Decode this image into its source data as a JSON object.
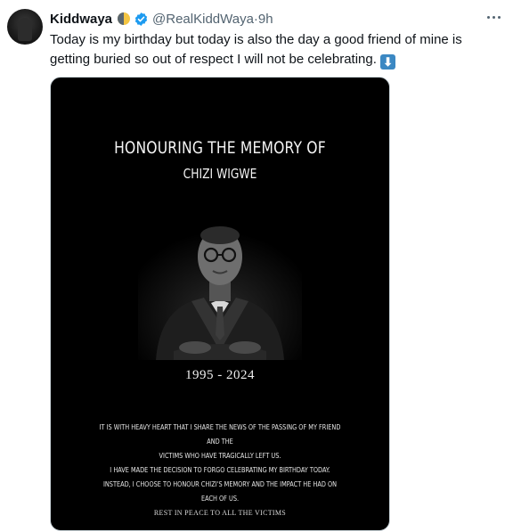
{
  "tweet": {
    "author_name": "Kiddwaya",
    "handle": "@RealKiddWaya",
    "separator": " · ",
    "time": "9h",
    "text": "Today is my birthday but today is also the day a good friend of mine is getting buried so out of respect I will not be celebrating.",
    "emoji": "⬇",
    "accent_color": "#1d9bf0"
  },
  "poster": {
    "title": "HONOURING THE MEMORY OF",
    "name": "CHIZI WIGWE",
    "years": "1995 - 2024",
    "message_1_line_1": "IT IS WITH HEAVY HEART THAT I SHARE THE NEWS OF THE PASSING OF MY FRIEND AND THE",
    "message_1_line_2": "VICTIMS WHO HAVE TRAGICALLY LEFT US.",
    "message_2_line_1": "I HAVE MADE THE DECISION TO FORGO CELEBRATING MY BIRTHDAY TODAY.",
    "message_2_line_2": "INSTEAD, I CHOOSE TO HONOUR CHIZI'S MEMORY AND THE IMPACT HE HAD ON EACH OF US.",
    "rip": "REST IN PEACE TO ALL THE VICTIMS"
  }
}
